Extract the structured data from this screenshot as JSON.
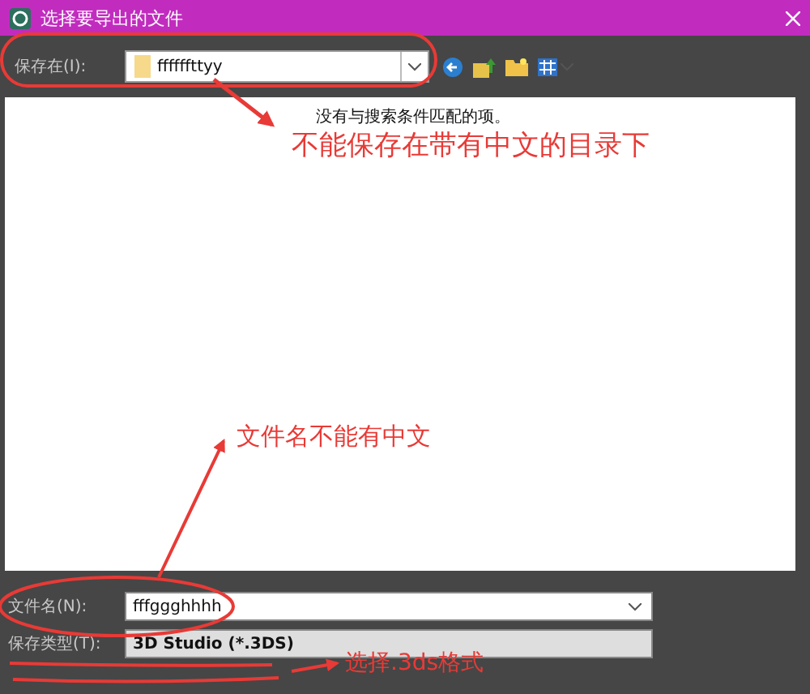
{
  "window": {
    "title": "选择要导出的文件"
  },
  "save_in": {
    "label": "保存在(I):",
    "value": "ffffffttyy"
  },
  "results": {
    "message": "没有与搜索条件匹配的项。"
  },
  "file_name": {
    "label": "文件名(N):",
    "value": "fffggghhhh"
  },
  "save_type": {
    "label": "保存类型(T):",
    "value": "3D Studio (*.3DS)"
  },
  "annotations": [
    {
      "text": "不能保存在带有中文的目录下"
    },
    {
      "text": "文件名不能有中文"
    },
    {
      "text": "选择.3ds格式"
    }
  ]
}
